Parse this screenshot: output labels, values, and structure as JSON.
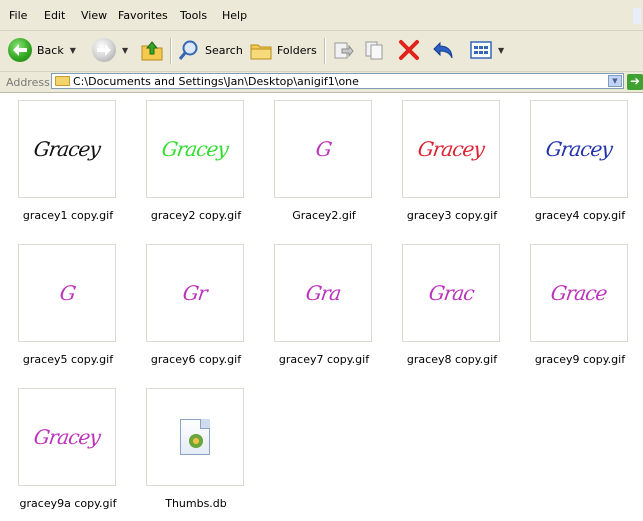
{
  "menu": [
    "File",
    "Edit",
    "View",
    "Favorites",
    "Tools",
    "Help"
  ],
  "toolbar": {
    "back_label": "Back",
    "search_label": "Search",
    "folders_label": "Folders"
  },
  "address": {
    "label": "Address",
    "path": "C:\\Documents and Settings\\Jan\\Desktop\\anigif1\\one"
  },
  "files": [
    {
      "name": "gracey1 copy.gif",
      "sig": "Gracey",
      "color": "#111111"
    },
    {
      "name": "gracey2 copy.gif",
      "sig": "Gracey",
      "color": "#33dd33"
    },
    {
      "name": "Gracey2.gif",
      "sig": "G",
      "color": "#bb33bb"
    },
    {
      "name": "gracey3 copy.gif",
      "sig": "Gracey",
      "color": "#dd2233"
    },
    {
      "name": "gracey4 copy.gif",
      "sig": "Gracey",
      "color": "#2233aa"
    },
    {
      "name": "gracey5 copy.gif",
      "sig": "G",
      "color": "#bb33bb"
    },
    {
      "name": "gracey6 copy.gif",
      "sig": "Gr",
      "color": "#bb33bb"
    },
    {
      "name": "gracey7 copy.gif",
      "sig": "Gra",
      "color": "#bb33bb"
    },
    {
      "name": "gracey8 copy.gif",
      "sig": "Grac",
      "color": "#bb33bb"
    },
    {
      "name": "gracey9 copy.gif",
      "sig": "Grace",
      "color": "#bb33bb"
    },
    {
      "name": "gracey9a copy.gif",
      "sig": "Gracey",
      "color": "#bb33bb"
    },
    {
      "name": "Thumbs.db",
      "sig": "",
      "color": "",
      "icon": "database-file-icon"
    }
  ]
}
